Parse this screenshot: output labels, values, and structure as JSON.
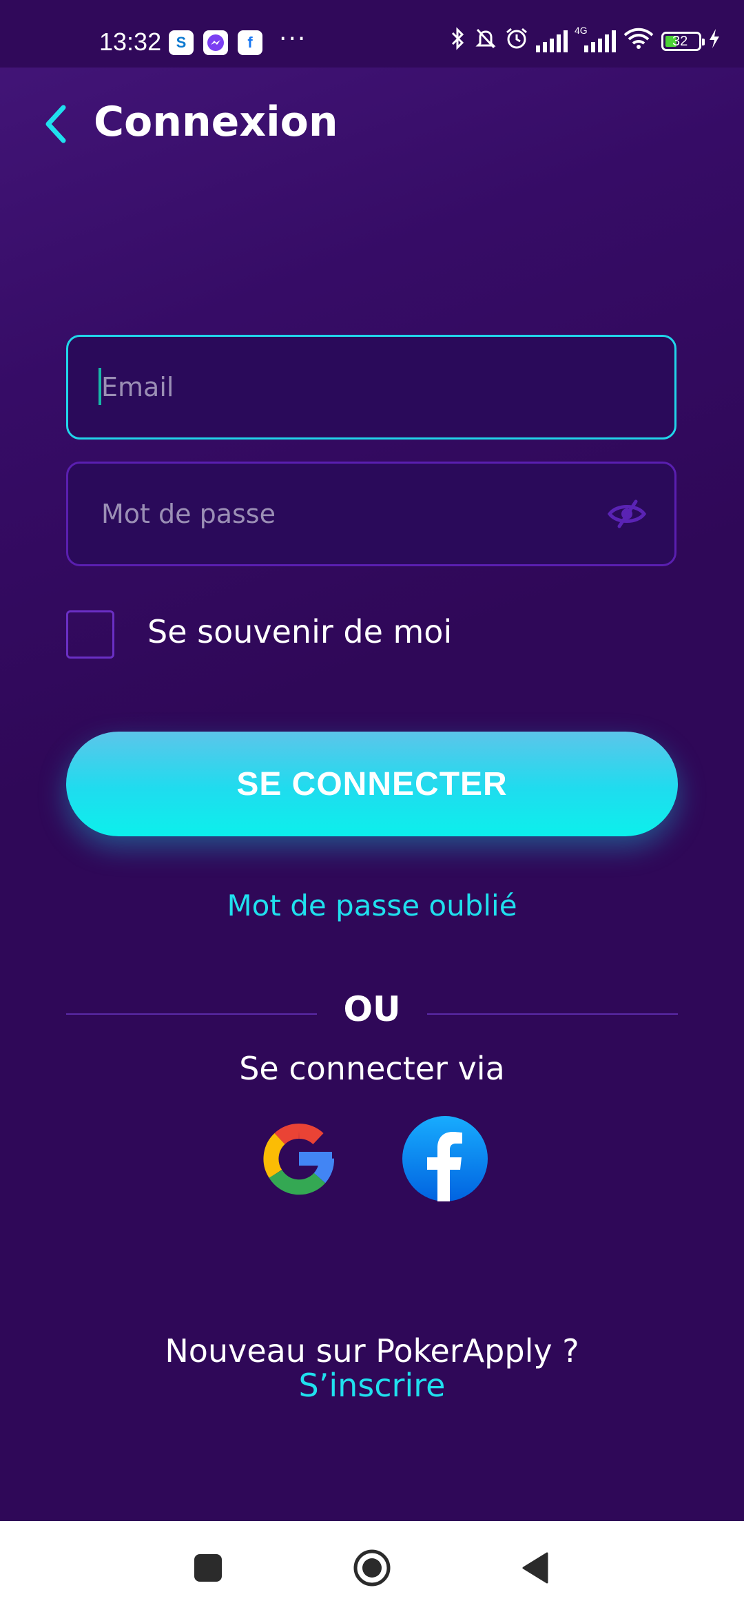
{
  "status_bar": {
    "time": "13:32",
    "notification_icons": [
      "skype-icon",
      "messenger-icon",
      "facebook-icon"
    ],
    "more": "···",
    "network_label": "4G",
    "battery_level": "32"
  },
  "header": {
    "title": "Connexion",
    "back_icon": "chevron-left-icon"
  },
  "form": {
    "email_placeholder": "Email",
    "email_value": "",
    "password_placeholder": "Mot de passe",
    "password_value": "",
    "remember_label": "Se souvenir de moi",
    "remember_checked": false,
    "submit_label": "SE CONNECTER",
    "forgot_label": "Mot de passe oublié"
  },
  "social": {
    "or_label": "OU",
    "via_label": "Se connecter via",
    "providers": [
      "google-icon",
      "facebook-icon"
    ]
  },
  "footer": {
    "new_user_label": "Nouveau sur PokerApply ?",
    "signup_label": "S’inscrire"
  },
  "colors": {
    "background": "#2f0858",
    "accent": "#20e0ee",
    "field_border": "#5a1fb0"
  }
}
